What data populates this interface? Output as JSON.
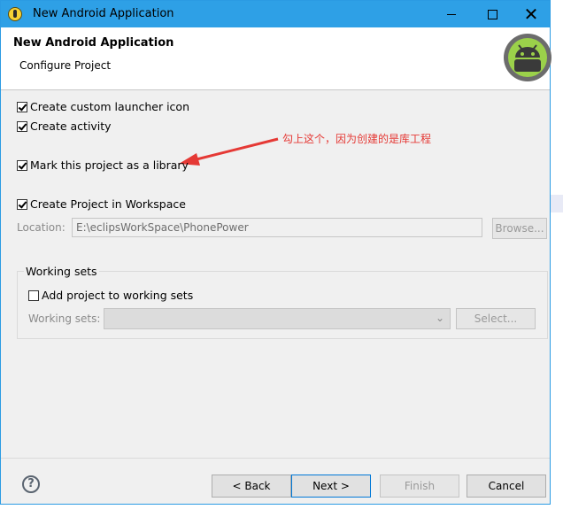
{
  "window": {
    "title": "New Android Application"
  },
  "header": {
    "title": "New Android Application",
    "subtitle": "Configure Project",
    "logo_icon": "android-logo-icon"
  },
  "options": {
    "launcher_icon": {
      "label": "Create custom launcher icon",
      "checked": true
    },
    "activity": {
      "label": "Create activity",
      "checked": true
    },
    "library": {
      "label": "Mark this project as a library",
      "checked": true
    },
    "workspace": {
      "label": "Create Project in Workspace",
      "checked": true
    }
  },
  "annotation": {
    "text": "勾上这个，因为创建的是库工程",
    "color": "#e53935"
  },
  "location": {
    "label": "Location:",
    "value": "E:\\eclipsWorkSpace\\PhonePower",
    "browse_label": "Browse..."
  },
  "working_sets": {
    "group_title": "Working sets",
    "add_label": "Add project to working sets",
    "add_checked": false,
    "sets_label": "Working sets:",
    "select_label": "Select..."
  },
  "buttons": {
    "back": "< Back",
    "next": "Next >",
    "finish": "Finish",
    "cancel": "Cancel"
  },
  "colors": {
    "titlebar": "#2ea0e6",
    "accent": "#0078d7"
  }
}
